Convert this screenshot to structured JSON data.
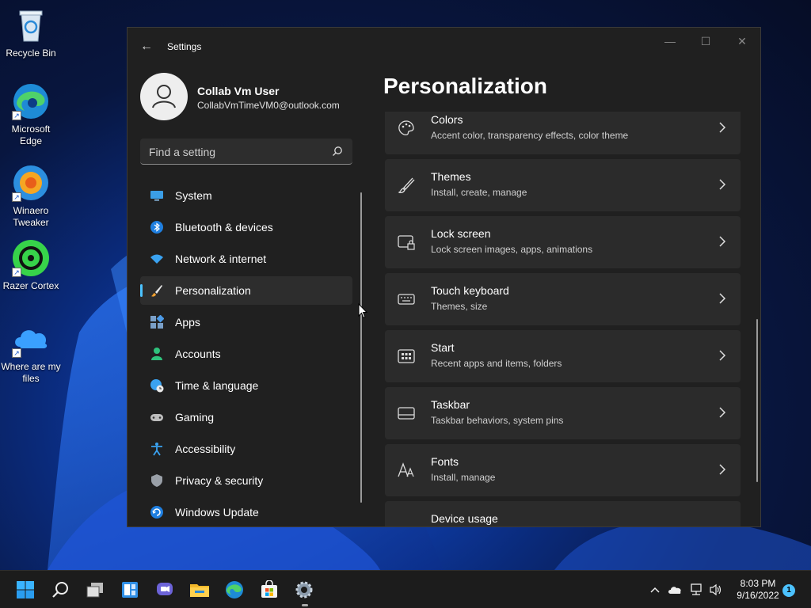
{
  "desktop": {
    "icons": [
      {
        "label": "Recycle Bin"
      },
      {
        "label": "Microsoft Edge"
      },
      {
        "label": "Winaero Tweaker"
      },
      {
        "label": "Razer Cortex"
      },
      {
        "label": "Where are my files"
      }
    ]
  },
  "window": {
    "title": "Settings",
    "back_label": "←",
    "minimize_label": "—",
    "maximize_label": "☐",
    "close_label": "✕"
  },
  "profile": {
    "name": "Collab Vm User",
    "email": "CollabVmTimeVM0@outlook.com"
  },
  "search": {
    "placeholder": "Find a setting"
  },
  "nav": {
    "items": [
      {
        "label": "System",
        "icon": "monitor-icon"
      },
      {
        "label": "Bluetooth & devices",
        "icon": "bluetooth-icon"
      },
      {
        "label": "Network & internet",
        "icon": "wifi-icon"
      },
      {
        "label": "Personalization",
        "icon": "brush-icon",
        "active": true
      },
      {
        "label": "Apps",
        "icon": "apps-icon"
      },
      {
        "label": "Accounts",
        "icon": "person-icon"
      },
      {
        "label": "Time & language",
        "icon": "globe-clock-icon"
      },
      {
        "label": "Gaming",
        "icon": "gamepad-icon"
      },
      {
        "label": "Accessibility",
        "icon": "accessibility-icon"
      },
      {
        "label": "Privacy & security",
        "icon": "shield-icon"
      },
      {
        "label": "Windows Update",
        "icon": "update-icon"
      }
    ]
  },
  "page": {
    "title": "Personalization",
    "cards": [
      {
        "title": "Colors",
        "subtitle": "Accent color, transparency effects, color theme",
        "icon": "palette-icon"
      },
      {
        "title": "Themes",
        "subtitle": "Install, create, manage",
        "icon": "brush-icon"
      },
      {
        "title": "Lock screen",
        "subtitle": "Lock screen images, apps, animations",
        "icon": "lock-screen-icon"
      },
      {
        "title": "Touch keyboard",
        "subtitle": "Themes, size",
        "icon": "keyboard-icon"
      },
      {
        "title": "Start",
        "subtitle": "Recent apps and items, folders",
        "icon": "start-icon"
      },
      {
        "title": "Taskbar",
        "subtitle": "Taskbar behaviors, system pins",
        "icon": "taskbar-icon"
      },
      {
        "title": "Fonts",
        "subtitle": "Install, manage",
        "icon": "fonts-icon"
      },
      {
        "title": "Device usage",
        "subtitle": "",
        "icon": "device-usage-icon"
      }
    ]
  },
  "taskbar": {
    "apps": [
      "start-icon",
      "search-icon",
      "task-view-icon",
      "widgets-icon",
      "teams-chat-icon",
      "file-explorer-icon",
      "edge-icon",
      "store-icon",
      "settings-icon"
    ],
    "clock": {
      "time": "8:03 PM",
      "date": "9/16/2022"
    },
    "notification_count": "1"
  },
  "colors": {
    "accent": "#4cc2ff",
    "window_bg": "#202020",
    "card_bg": "#2b2b2b"
  }
}
